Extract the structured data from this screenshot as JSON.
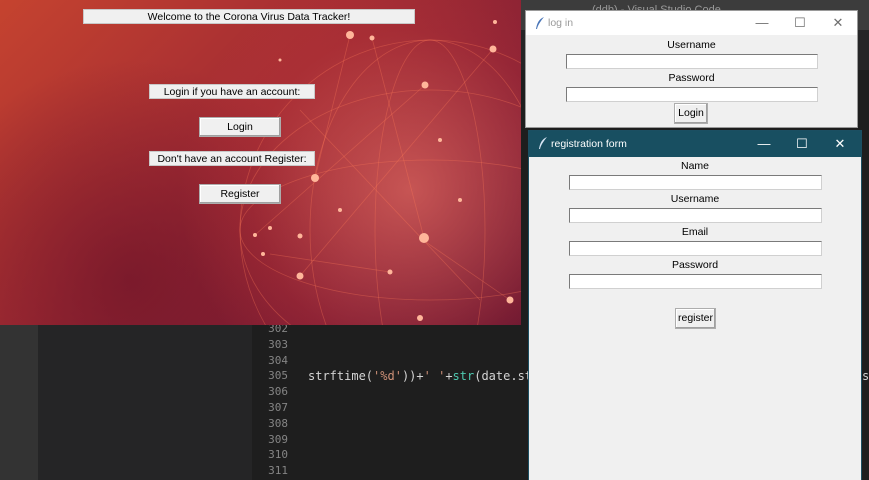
{
  "vscode": {
    "title_fragment": "…(ddb) - Visual Studio Code",
    "line_numbers": [
      "302",
      "303",
      "304",
      "305",
      "306",
      "307",
      "308",
      "309",
      "310",
      "311"
    ],
    "code_305": {
      "part1": "strftime(",
      "str1": "'%d'",
      "part2": "))+",
      "str2": "' '",
      "part3": "+",
      "fn": "str",
      "part4": "(date.strfti"
    },
    "code_tail": "s"
  },
  "tracker": {
    "welcome": "Welcome to the Corona Virus Data Tracker!",
    "login_prompt": "Login if you have an account:",
    "login_button": "Login",
    "register_prompt": "Don't have an account Register:",
    "register_button": "Register"
  },
  "login_window": {
    "title": "log in",
    "username_label": "Username",
    "username_value": "",
    "password_label": "Password",
    "password_value": "",
    "login_button": "Login"
  },
  "registration_window": {
    "title": "registration form",
    "name_label": "Name",
    "name_value": "",
    "username_label": "Username",
    "username_value": "",
    "email_label": "Email",
    "email_value": "",
    "password_label": "Password",
    "password_value": "",
    "register_button": "register"
  },
  "window_controls": {
    "minimize": "—",
    "maximize": "☐",
    "close": "✕"
  },
  "icons": {
    "window_icon": "feather-icon"
  },
  "colors": {
    "reg_titlebar": "#184f61",
    "tk_bg": "#f0f0f0",
    "tracker_red": "#a52d33"
  }
}
